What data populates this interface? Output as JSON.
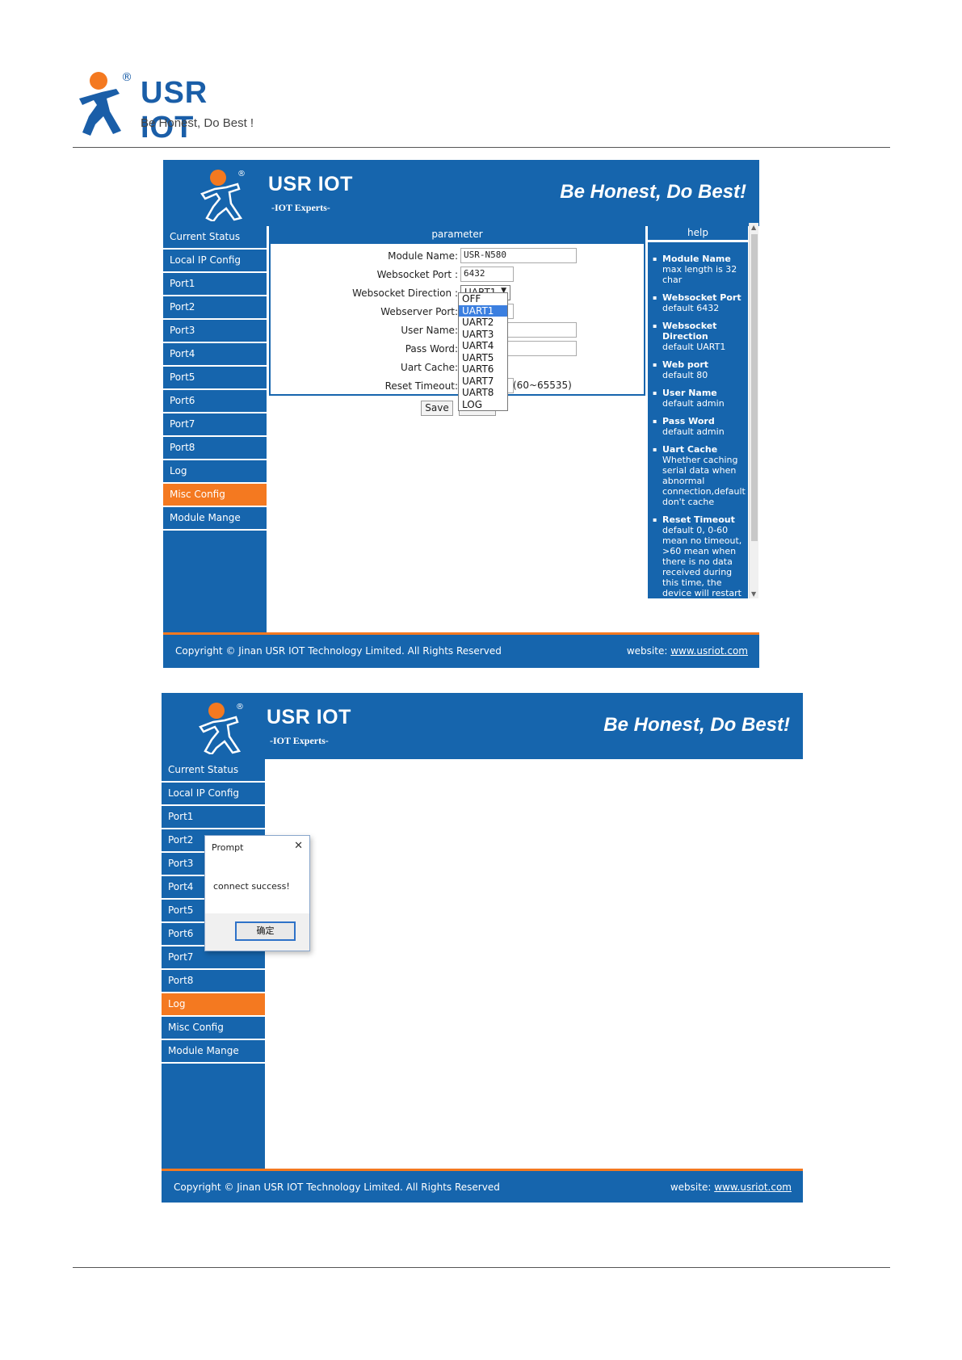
{
  "document": {
    "logo_text": "USR IOT",
    "logo_registered": "®",
    "logo_tagline": "Be Honest, Do Best !"
  },
  "screen1": {
    "header": {
      "brand": "USR IOT",
      "sub": "-IOT Experts-",
      "slogan": "Be Honest, Do Best!"
    },
    "sidebar": [
      {
        "label": "Current Status",
        "active": false
      },
      {
        "label": "Local IP Config",
        "active": false
      },
      {
        "label": "Port1",
        "active": false
      },
      {
        "label": "Port2",
        "active": false
      },
      {
        "label": "Port3",
        "active": false
      },
      {
        "label": "Port4",
        "active": false
      },
      {
        "label": "Port5",
        "active": false
      },
      {
        "label": "Port6",
        "active": false
      },
      {
        "label": "Port7",
        "active": false
      },
      {
        "label": "Port8",
        "active": false
      },
      {
        "label": "Log",
        "active": false
      },
      {
        "label": "Misc Config",
        "active": true
      },
      {
        "label": "Module Mange",
        "active": false
      }
    ],
    "parameter": {
      "title": "parameter",
      "module_name_label": "Module Name:",
      "module_name_value": "USR-N580",
      "ws_port_label": "Websocket Port :",
      "ws_port_value": "6432",
      "ws_direction_label": "Websocket Direction :",
      "ws_direction_value": "UART1",
      "webserver_port_label": "Webserver Port:",
      "user_name_label": "User Name:",
      "pass_word_label": "Pass Word:",
      "uart_cache_label": "Uart Cache:",
      "reset_timeout_label": "Reset Timeout:",
      "reset_timeout_hint": "(60~65535)",
      "direction_options": [
        "OFF",
        "UART1",
        "UART2",
        "UART3",
        "UART4",
        "UART5",
        "UART6",
        "UART7",
        "UART8",
        "LOG"
      ],
      "direction_selected": "UART1",
      "save_label": "Save"
    },
    "help": {
      "title": "help",
      "items": [
        {
          "title": "Module Name",
          "text": "max length is 32 char"
        },
        {
          "title": "Websocket Port",
          "text": "default 6432"
        },
        {
          "title": "Websocket Direction",
          "text": "default UART1"
        },
        {
          "title": "Web port",
          "text": "default 80"
        },
        {
          "title": "User Name",
          "text": "default admin"
        },
        {
          "title": "Pass Word",
          "text": "default admin"
        },
        {
          "title": "Uart Cache",
          "text": "Whether caching serial data when abnormal connection,default don't cache"
        },
        {
          "title": "Reset Timeout",
          "text": "default 0, 0-60 mean no timeout, >60 mean when there is no data received during this time, the device will restart"
        }
      ]
    },
    "footer": {
      "copyright": "Copyright © Jinan USR IOT Technology Limited. All Rights Reserved",
      "website_label": "website:",
      "website_url": "www.usriot.com"
    }
  },
  "screen2": {
    "header": {
      "brand": "USR IOT",
      "sub": "-IOT Experts-",
      "slogan": "Be Honest, Do Best!"
    },
    "sidebar": [
      {
        "label": "Current Status",
        "active": false
      },
      {
        "label": "Local IP Config",
        "active": false
      },
      {
        "label": "Port1",
        "active": false
      },
      {
        "label": "Port2",
        "active": false
      },
      {
        "label": "Port3",
        "active": false
      },
      {
        "label": "Port4",
        "active": false
      },
      {
        "label": "Port5",
        "active": false
      },
      {
        "label": "Port6",
        "active": false
      },
      {
        "label": "Port7",
        "active": false
      },
      {
        "label": "Port8",
        "active": false
      },
      {
        "label": "Log",
        "active": true
      },
      {
        "label": "Misc Config",
        "active": false
      },
      {
        "label": "Module Mange",
        "active": false
      }
    ],
    "dialog": {
      "title": "Prompt",
      "close": "✕",
      "message": "connect success!",
      "ok_label": "确定"
    },
    "footer": {
      "copyright": "Copyright © Jinan USR IOT Technology Limited. All Rights Reserved",
      "website_label": "website:",
      "website_url": "www.usriot.com"
    }
  },
  "colors": {
    "brand_blue": "#1665ad",
    "accent_orange": "#f47920",
    "selected_option": "#3b7fe0"
  }
}
